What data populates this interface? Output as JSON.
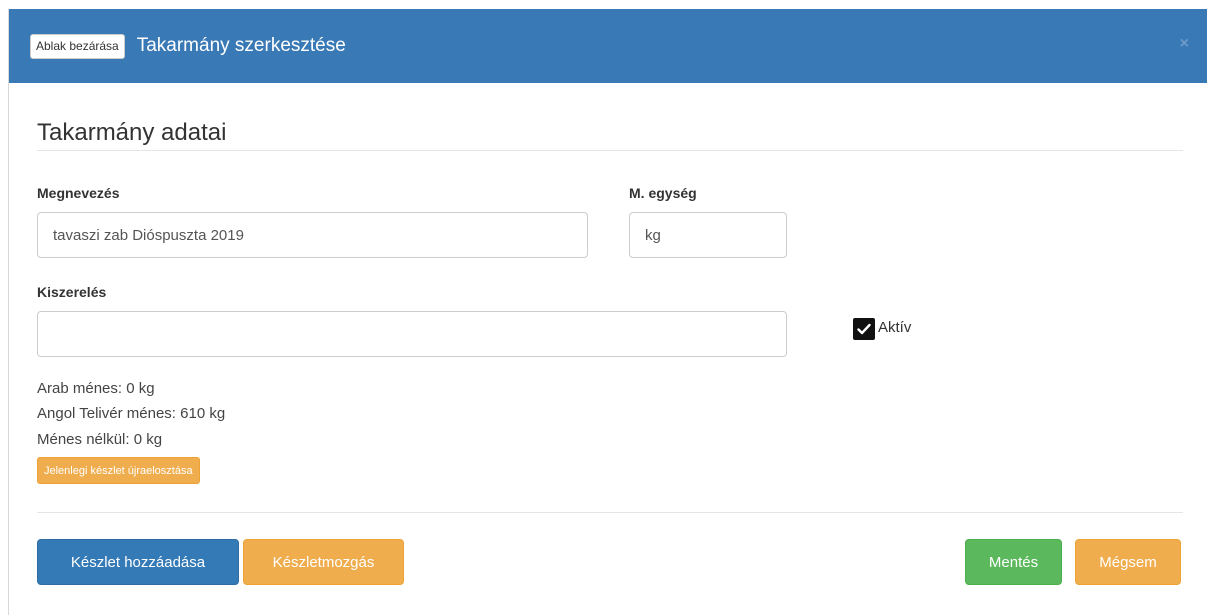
{
  "header": {
    "close_label": "Ablak bezárása",
    "title": "Takarmány szerkesztése",
    "x_glyph": "×"
  },
  "section": {
    "title": "Takarmány adatai"
  },
  "form": {
    "name": {
      "label": "Megnevezés",
      "value": "tavaszi zab Dióspuszta 2019"
    },
    "unit": {
      "label": "M. egység",
      "value": "kg"
    },
    "packaging": {
      "label": "Kiszerelés",
      "value": ""
    },
    "active": {
      "label": "Aktív",
      "checked": true
    }
  },
  "stock": {
    "lines": [
      "Arab ménes: 0 kg",
      "Angol Telivér ménes: 610 kg",
      "Ménes nélkül: 0 kg"
    ],
    "redistribute_label": "Jelenlegi készlet újraelosztása"
  },
  "footer": {
    "add_stock_label": "Készlet hozzáadása",
    "movement_label": "Készletmozgás",
    "save_label": "Mentés",
    "cancel_label": "Mégsem"
  },
  "colors": {
    "header_bg": "#3979b5",
    "primary": "#337ab7",
    "warning": "#f0ad4e",
    "success": "#5cb85c"
  }
}
